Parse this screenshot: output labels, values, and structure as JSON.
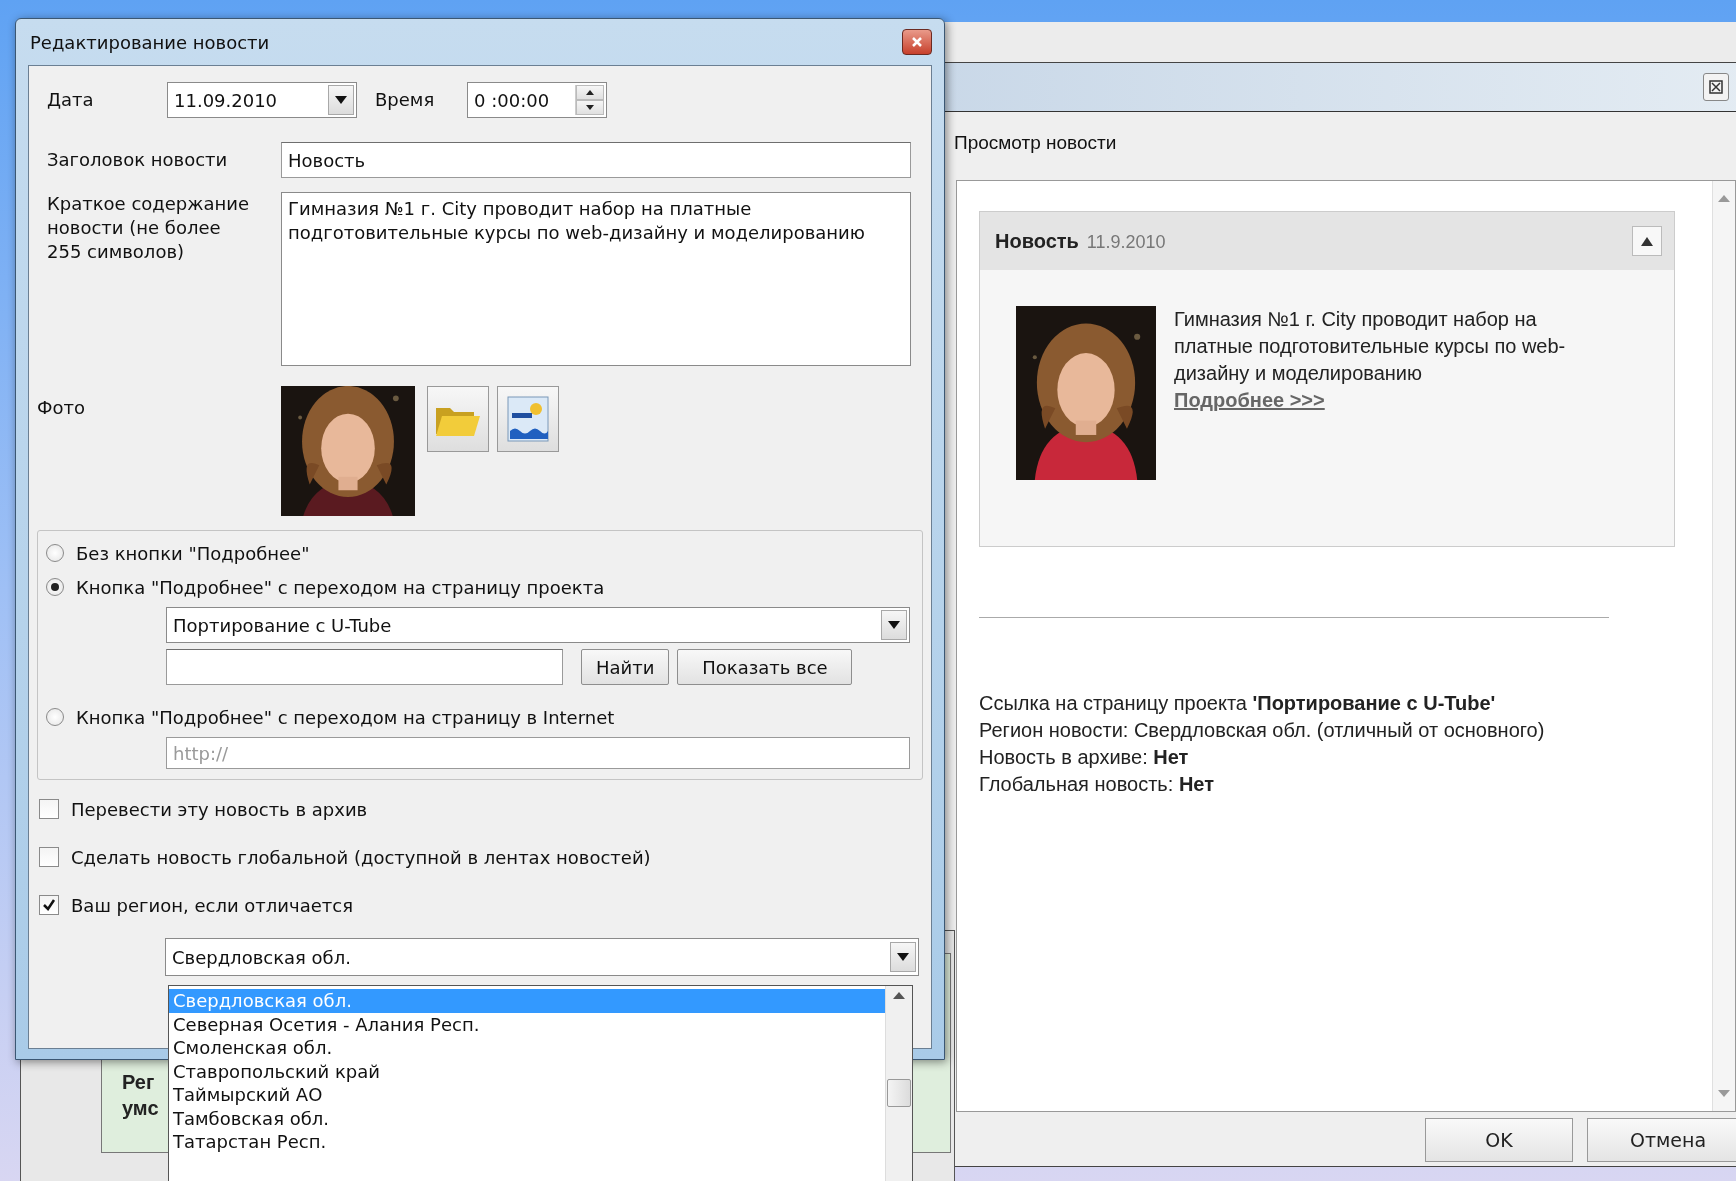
{
  "edit_dialog": {
    "title": "Редактирование новости",
    "date": {
      "label": "Дата",
      "value": "11.09.2010"
    },
    "time": {
      "label": "Время",
      "value": "0 :00:00"
    },
    "headline": {
      "label": "Заголовок новости",
      "value": "Новость"
    },
    "summary": {
      "label_lines": [
        "Краткое содержание",
        "новости (не более",
        "255 символов)"
      ],
      "value": "Гимназия №1 г. City проводит набор на платные подготовительные курсы по web-дизайну и моделированию"
    },
    "photo": {
      "label": "Фото"
    },
    "link_options": [
      {
        "label": "Без кнопки \"Подробнее\"",
        "selected": false
      },
      {
        "label": "Кнопка \"Подробнее\" с переходом на страницу проекта",
        "selected": true
      },
      {
        "label": "Кнопка \"Подробнее\" с переходом на страницу в Internet",
        "selected": false
      }
    ],
    "project": {
      "value": "Портирование с U-Tube"
    },
    "find_buttons": [
      "Найти",
      "Показать все"
    ],
    "url": {
      "placeholder": "http://"
    },
    "checkboxes": [
      {
        "label": "Перевести эту новость в архив",
        "checked": false
      },
      {
        "label": "Сделать новость глобальной (доступной в лентах новостей)",
        "checked": false
      },
      {
        "label": "Ваш регион, если отличается",
        "checked": true
      }
    ],
    "region": {
      "value": "Свердловская обл.",
      "options": [
        {
          "label": "Свердловская обл.",
          "selected": true
        },
        {
          "label": "Северная Осетия - Алания Респ.",
          "selected": false
        },
        {
          "label": "Смоленская обл.",
          "selected": false
        },
        {
          "label": "Ставропольский край",
          "selected": false
        },
        {
          "label": "Таймырский АО",
          "selected": false
        },
        {
          "label": "Тамбовская обл.",
          "selected": false
        },
        {
          "label": "Татарстан Респ.",
          "selected": false
        }
      ]
    }
  },
  "preview_window": {
    "section_title": "Просмотр новости",
    "card": {
      "title": "Новость",
      "date": "11.9.2010",
      "expanded": true,
      "text": "Гимназия №1 г. City проводит набор на платные подготовительные курсы по web-дизайну и моделированию",
      "more_link": "Подробнее >>>"
    },
    "info_lines": [
      "Ссылка на страницу проекта **'Портирование с U-Tube'**",
      "Регион новости: Свердловская обл. (отличный от основного)",
      "Новость в архиве: **Нет**",
      "Глобальная новость: **Нет**"
    ],
    "buttons": [
      "OK",
      "Отмена"
    ]
  },
  "back_window": {
    "texts": [
      "Рег",
      "умс"
    ]
  }
}
